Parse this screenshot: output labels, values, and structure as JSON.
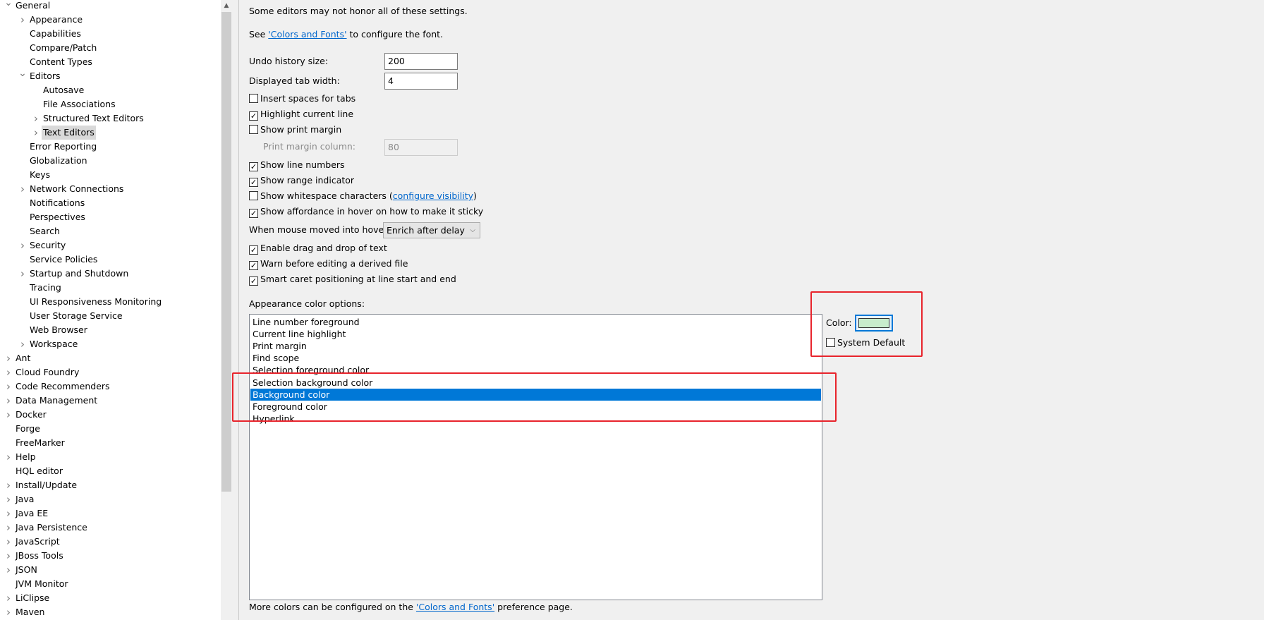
{
  "sidebar": {
    "items": [
      {
        "label": "General",
        "level": 0,
        "chevron": "expanded"
      },
      {
        "label": "Appearance",
        "level": 1,
        "chevron": "collapsed"
      },
      {
        "label": "Capabilities",
        "level": 1,
        "chevron": "none"
      },
      {
        "label": "Compare/Patch",
        "level": 1,
        "chevron": "none"
      },
      {
        "label": "Content Types",
        "level": 1,
        "chevron": "none"
      },
      {
        "label": "Editors",
        "level": 1,
        "chevron": "expanded"
      },
      {
        "label": "Autosave",
        "level": 2,
        "chevron": "none"
      },
      {
        "label": "File Associations",
        "level": 2,
        "chevron": "none"
      },
      {
        "label": "Structured Text Editors",
        "level": 2,
        "chevron": "collapsed"
      },
      {
        "label": "Text Editors",
        "level": 2,
        "chevron": "collapsed",
        "selected": true
      },
      {
        "label": "Error Reporting",
        "level": 1,
        "chevron": "none"
      },
      {
        "label": "Globalization",
        "level": 1,
        "chevron": "none"
      },
      {
        "label": "Keys",
        "level": 1,
        "chevron": "none"
      },
      {
        "label": "Network Connections",
        "level": 1,
        "chevron": "collapsed"
      },
      {
        "label": "Notifications",
        "level": 1,
        "chevron": "none"
      },
      {
        "label": "Perspectives",
        "level": 1,
        "chevron": "none"
      },
      {
        "label": "Search",
        "level": 1,
        "chevron": "none"
      },
      {
        "label": "Security",
        "level": 1,
        "chevron": "collapsed"
      },
      {
        "label": "Service Policies",
        "level": 1,
        "chevron": "none"
      },
      {
        "label": "Startup and Shutdown",
        "level": 1,
        "chevron": "collapsed"
      },
      {
        "label": "Tracing",
        "level": 1,
        "chevron": "none"
      },
      {
        "label": "UI Responsiveness Monitoring",
        "level": 1,
        "chevron": "none"
      },
      {
        "label": "User Storage Service",
        "level": 1,
        "chevron": "none"
      },
      {
        "label": "Web Browser",
        "level": 1,
        "chevron": "none"
      },
      {
        "label": "Workspace",
        "level": 1,
        "chevron": "collapsed"
      },
      {
        "label": "Ant",
        "level": 0,
        "chevron": "collapsed"
      },
      {
        "label": "Cloud Foundry",
        "level": 0,
        "chevron": "collapsed"
      },
      {
        "label": "Code Recommenders",
        "level": 0,
        "chevron": "collapsed"
      },
      {
        "label": "Data Management",
        "level": 0,
        "chevron": "collapsed"
      },
      {
        "label": "Docker",
        "level": 0,
        "chevron": "collapsed"
      },
      {
        "label": "Forge",
        "level": 0,
        "chevron": "none"
      },
      {
        "label": "FreeMarker",
        "level": 0,
        "chevron": "none"
      },
      {
        "label": "Help",
        "level": 0,
        "chevron": "collapsed"
      },
      {
        "label": "HQL editor",
        "level": 0,
        "chevron": "none"
      },
      {
        "label": "Install/Update",
        "level": 0,
        "chevron": "collapsed"
      },
      {
        "label": "Java",
        "level": 0,
        "chevron": "collapsed"
      },
      {
        "label": "Java EE",
        "level": 0,
        "chevron": "collapsed"
      },
      {
        "label": "Java Persistence",
        "level": 0,
        "chevron": "collapsed"
      },
      {
        "label": "JavaScript",
        "level": 0,
        "chevron": "collapsed"
      },
      {
        "label": "JBoss Tools",
        "level": 0,
        "chevron": "collapsed"
      },
      {
        "label": "JSON",
        "level": 0,
        "chevron": "collapsed"
      },
      {
        "label": "JVM Monitor",
        "level": 0,
        "chevron": "none"
      },
      {
        "label": "LiClipse",
        "level": 0,
        "chevron": "collapsed"
      },
      {
        "label": "Maven",
        "level": 0,
        "chevron": "collapsed"
      }
    ]
  },
  "main": {
    "note": "Some editors may not honor all of these settings.",
    "see_prefix": "See ",
    "see_link": "'Colors and Fonts'",
    "see_suffix": " to configure the font.",
    "undo_label": "Undo history size:",
    "undo_value": "200",
    "tab_label": "Displayed tab width:",
    "tab_value": "4",
    "insert_spaces": {
      "label": "Insert spaces for tabs",
      "checked": false
    },
    "highlight_line": {
      "label": "Highlight current line",
      "checked": true
    },
    "print_margin": {
      "label": "Show print margin",
      "checked": false
    },
    "margin_col_label": "Print margin column:",
    "margin_col_value": "80",
    "line_numbers": {
      "label": "Show line numbers",
      "checked": true
    },
    "range_indicator": {
      "label": "Show range indicator",
      "checked": true
    },
    "whitespace": {
      "label": "Show whitespace characters (",
      "link": "configure visibility",
      "suffix": ")",
      "checked": false
    },
    "affordance": {
      "label": "Show affordance in hover on how to make it sticky",
      "checked": true
    },
    "hover_label": "When mouse moved into hover:",
    "hover_value": "Enrich after delay",
    "drag_drop": {
      "label": "Enable drag and drop of text",
      "checked": true
    },
    "warn_derived": {
      "label": "Warn before editing a derived file",
      "checked": true
    },
    "smart_caret": {
      "label": "Smart caret positioning at line start and end",
      "checked": true
    },
    "appearance_label": "Appearance color options:",
    "color_options": [
      "Line number foreground",
      "Current line highlight",
      "Print margin",
      "Find scope",
      "Selection foreground color",
      "Selection background color",
      "Background color",
      "Foreground color",
      "Hyperlink"
    ],
    "selected_option": "Background color",
    "color_label": "Color:",
    "color_value": "#c7edcc",
    "system_default": {
      "label": "System Default",
      "checked": false
    },
    "footer_prefix": "More colors can be configured on the ",
    "footer_link": "'Colors and Fonts'",
    "footer_suffix": " preference page."
  },
  "colors": {
    "selection": "#0078d7",
    "annotation": "#e8242c",
    "link": "#0066cc"
  }
}
